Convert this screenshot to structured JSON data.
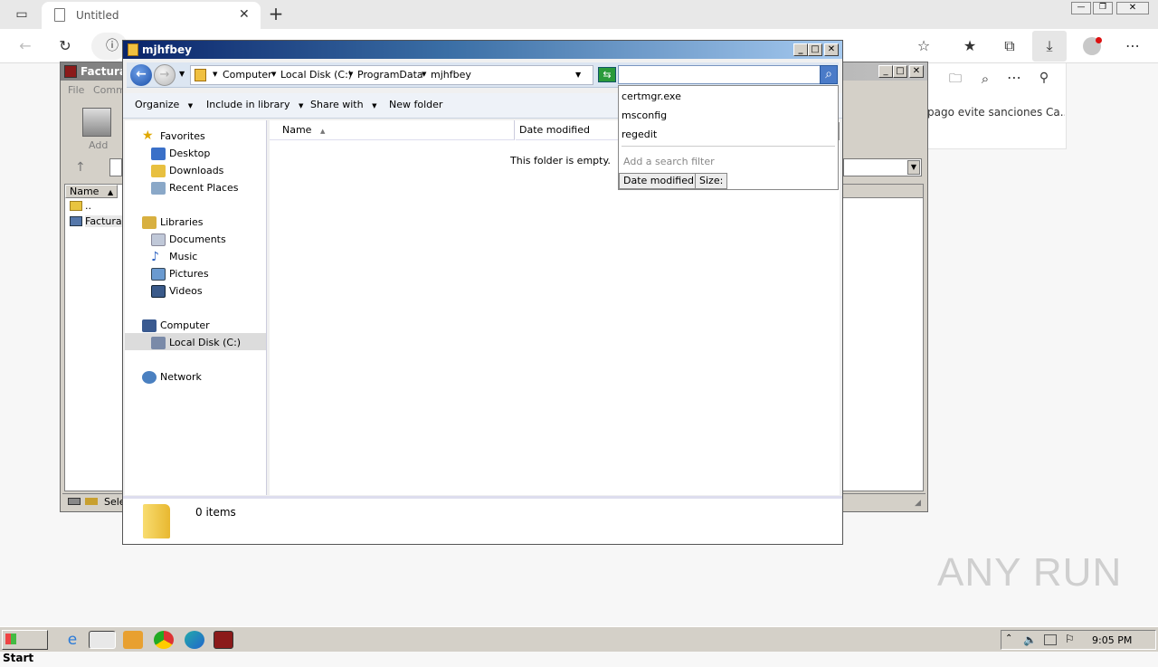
{
  "browser": {
    "tab_title": "Untitled",
    "side_panel_text": "pago evite sanciones Ca..."
  },
  "rar_window": {
    "title": "Factura",
    "menu_file": "File",
    "menu_commands": "Comm",
    "add_label": "Add",
    "col_name": "Name",
    "row_parent": "..",
    "row_file": "Factura",
    "status_text": "Sele"
  },
  "explorer": {
    "title": "mjhfbey",
    "breadcrumb": [
      "Computer",
      "Local Disk (C:)",
      "ProgramData",
      "mjhfbey"
    ],
    "search_value": "",
    "commands": {
      "organize": "Organize",
      "include_library": "Include in library",
      "share_with": "Share with",
      "new_folder": "New folder"
    },
    "columns": {
      "name": "Name",
      "date_modified": "Date modified"
    },
    "empty_message": "This folder is empty.",
    "nav": {
      "favorites": "Favorites",
      "desktop": "Desktop",
      "downloads": "Downloads",
      "recent": "Recent Places",
      "libraries": "Libraries",
      "documents": "Documents",
      "music": "Music",
      "pictures": "Pictures",
      "videos": "Videos",
      "computer": "Computer",
      "local_disk": "Local Disk (C:)",
      "network": "Network"
    },
    "status_items": "0 items",
    "search_suggestions": [
      "certmgr.exe",
      "msconfig",
      "regedit"
    ],
    "search_filter_placeholder": "Add a search filter",
    "filter_date": "Date modified:",
    "filter_size": "Size:"
  },
  "taskbar": {
    "start_label": "Start",
    "clock": "9:05 PM"
  },
  "watermark": "ANY RUN"
}
